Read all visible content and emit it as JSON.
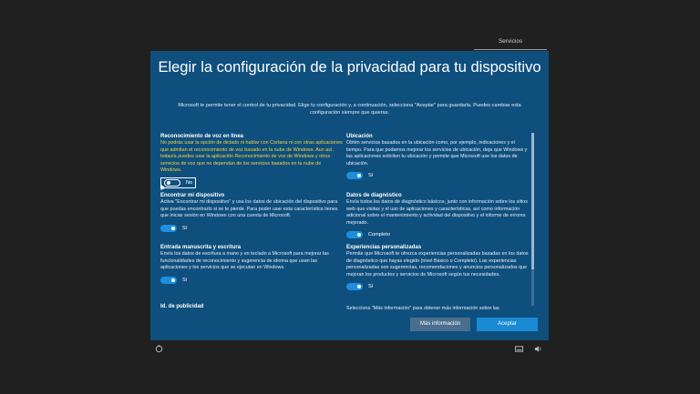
{
  "top_tab": {
    "label": "Servicios"
  },
  "dialog": {
    "title": "Elegir la configuración de la privacidad para tu dispositivo",
    "subtitle": "Microsoft te permite tener el control de tu privacidad. Elige tu configuración y, a continuación, selecciona \"Aceptar\" para guardarla. Puedes cambiar esta configuración siempre que quieras."
  },
  "left_sections": [
    {
      "title": "Reconocimiento de voz en línea",
      "warning": "No podrás usar la opción de dictado ni hablar con Cortana ni con otras aplicaciones que admitan el reconocimiento de voz basado en la nube de Windows. Aun así, todavía puedes usar la aplicación Reconocimiento de voz de Windows y otros servicios de voz que no dependan de los servicios basados en la nube de Windows.",
      "toggle_label": "No",
      "toggle_on": false
    },
    {
      "title": "Encontrar mi dispositivo",
      "desc": "Activa \"Encontrar mi dispositivo\" y usa los datos de ubicación del dispositivo para que puedas encontrarlo si se te pierde. Para poder usar esta característica tienes que iniciar sesión en Windows con una cuenta de Microsoft.",
      "toggle_label": "Sí",
      "toggle_on": true
    },
    {
      "title": "Entrada manuscrita y escritura",
      "desc": "Envía los datos de escritura a mano y en teclado a Microsoft para mejorar las funcionalidades de reconocimiento y sugerencia de idioma que usan las aplicaciones y los servicios que se ejecutan en Windows.",
      "toggle_label": "Sí",
      "toggle_on": true
    },
    {
      "title": "Id. de publicidad"
    }
  ],
  "right_sections": [
    {
      "title": "Ubicación",
      "desc": "Obtén servicios basados en la ubicación como, por ejemplo, indicaciones y el tiempo. Para que podamos mejorar los servicios de ubicación, deja que Windows y las aplicaciones soliciten tu ubicación y permite que Microsoft use los datos de ubicación.",
      "toggle_label": "Sí",
      "toggle_on": true
    },
    {
      "title": "Datos de diagnóstico",
      "desc": "Envía todos los datos de diagnóstico básicos, junto con información sobre los sitios web que visitas y el uso de aplicaciones y características, así como información adicional sobre el mantenimiento y actividad del dispositivo y el informe de errores mejorado.",
      "toggle_label": "Completo",
      "toggle_on": true
    },
    {
      "title": "Experiencias personalizadas",
      "desc": "Permite que Microsoft te ofrezca experiencias personalizadas basadas en los datos de diagnóstico que hayas elegido (nivel Básico o Completo). Las experiencias personalizadas son sugerencias, recomendaciones y anuncios personalizados que mejoran los productos y servicios de Microsoft según tus necesidades.",
      "toggle_label": "Sí",
      "toggle_on": true
    },
    {
      "desc": "Selecciona \"Más información\" para obtener más información sobre las"
    }
  ],
  "buttons": {
    "more_info": "Más información",
    "accept": "Aceptar"
  },
  "bottom_icons": {
    "left": "accessibility-icon",
    "keyboard": "keyboard-icon",
    "volume": "volume-icon"
  }
}
